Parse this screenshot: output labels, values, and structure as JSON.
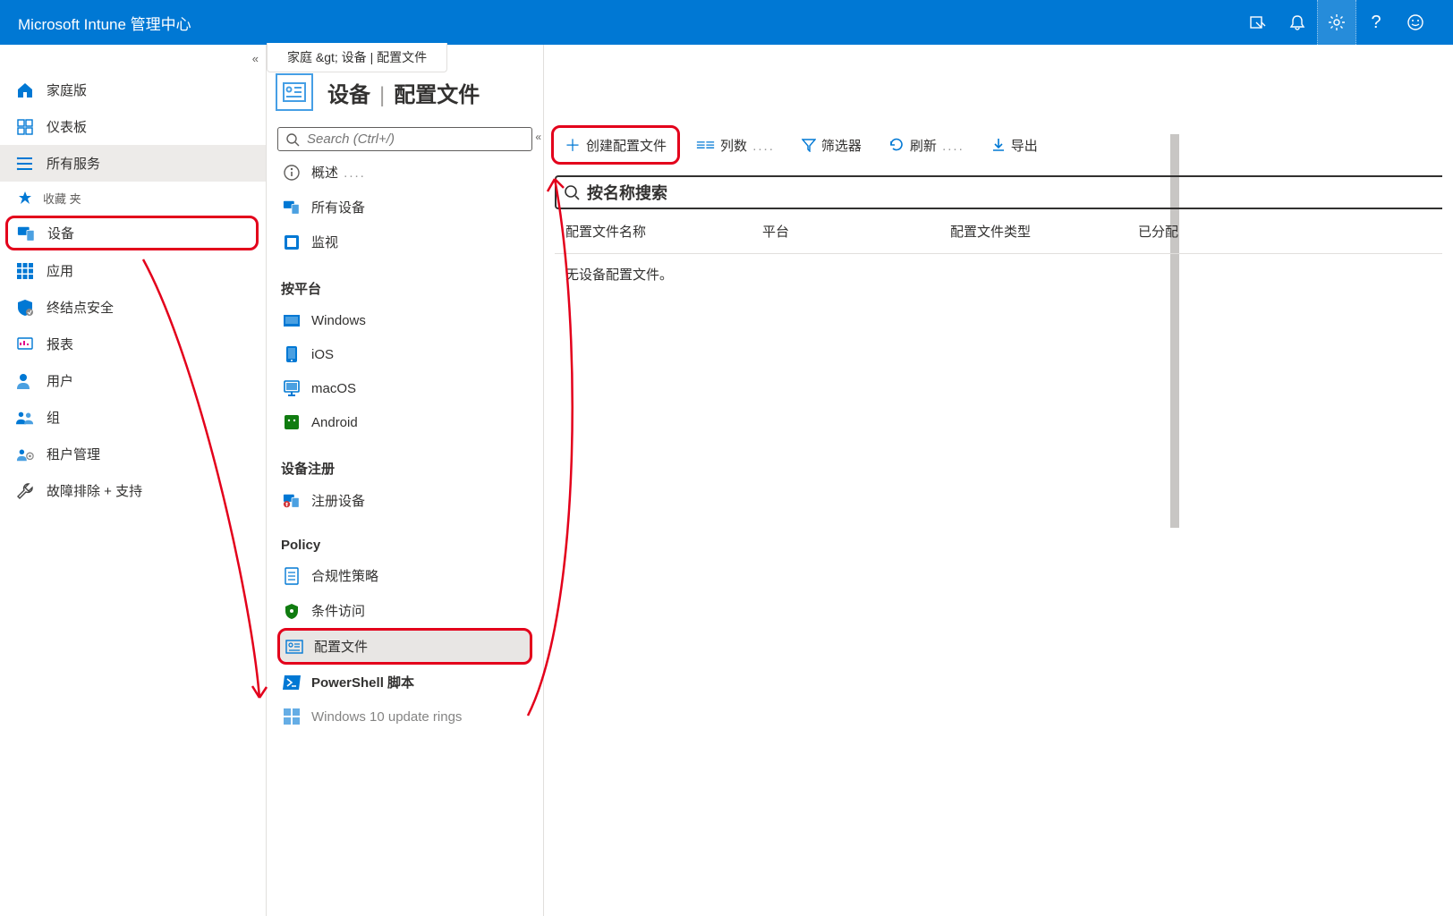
{
  "topbar": {
    "title": "Microsoft Intune 管理中心"
  },
  "breadcrumb": "家庭 &gt;   设备 | 配置文件",
  "page": {
    "main": "设备",
    "sep": "|",
    "sub": "配置文件"
  },
  "sidebar": {
    "items": [
      {
        "label": "家庭版"
      },
      {
        "label": "仪表板"
      },
      {
        "label": "所有服务"
      }
    ],
    "fav_label": "收藏 夹",
    "fav_items": [
      {
        "label": "设备"
      },
      {
        "label": "应用"
      },
      {
        "label": "终结点安全"
      },
      {
        "label": "报表"
      },
      {
        "label": "用户"
      },
      {
        "label": "组"
      },
      {
        "label": "租户管理"
      },
      {
        "label": "故障排除 + 支持"
      }
    ]
  },
  "mid": {
    "search_placeholder": "Search (Ctrl+/)",
    "top_items": [
      {
        "label": "概述"
      },
      {
        "label": "所有设备"
      },
      {
        "label": "监视"
      }
    ],
    "section_platform": "按平台",
    "platform_items": [
      {
        "label": "Windows"
      },
      {
        "label": "iOS"
      },
      {
        "label": "macOS"
      },
      {
        "label": "Android"
      }
    ],
    "section_enroll": "设备注册",
    "enroll_items": [
      {
        "label": "注册设备"
      }
    ],
    "section_policy": "Policy",
    "policy_items": [
      {
        "label": "合规性策略"
      },
      {
        "label": "条件访问"
      },
      {
        "label": "配置文件"
      },
      {
        "label": "PowerShell 脚本"
      },
      {
        "label": "Windows 10 update rings"
      }
    ]
  },
  "toolbar": {
    "create": "创建配置文件",
    "columns": "列数",
    "filter": "筛选器",
    "refresh": "刷新",
    "export": "导出"
  },
  "main_search": "按名称搜索",
  "columns_header": {
    "name": "配置文件名称",
    "platform": "平台",
    "type": "配置文件类型",
    "assigned": "已分配"
  },
  "empty": "无设备配置文件。"
}
